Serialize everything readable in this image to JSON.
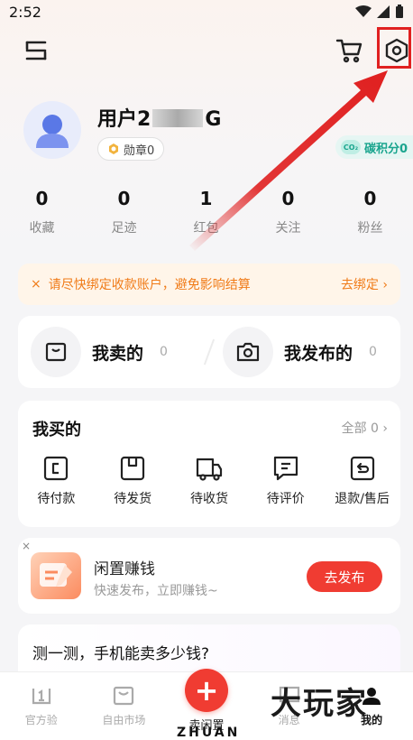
{
  "status_bar": {
    "time": "2:52"
  },
  "profile": {
    "username_prefix": "用户2",
    "username_suffix": "G",
    "badge_label": "勋章0",
    "carbon_label": "碳积分0",
    "co2_text": "CO₂"
  },
  "stats": [
    {
      "value": "0",
      "label": "收藏"
    },
    {
      "value": "0",
      "label": "足迹"
    },
    {
      "value": "1",
      "label": "红包"
    },
    {
      "value": "0",
      "label": "关注"
    },
    {
      "value": "0",
      "label": "粉丝"
    }
  ],
  "notice": {
    "close": "×",
    "message": "请尽快绑定收款账户，避免影响结算",
    "action": "去绑定 ›"
  },
  "sell": {
    "sold_label": "我卖的",
    "sold_count": "0",
    "published_label": "我发布的",
    "published_count": "0"
  },
  "bought": {
    "title": "我买的",
    "all_label": "全部 0 ›",
    "items": [
      {
        "label": "待付款",
        "icon": "pay-icon"
      },
      {
        "label": "待发货",
        "icon": "ship-icon"
      },
      {
        "label": "待收货",
        "icon": "truck-icon"
      },
      {
        "label": "待评价",
        "icon": "review-icon"
      },
      {
        "label": "退款/售后",
        "icon": "refund-icon"
      }
    ]
  },
  "promo": {
    "close": "×",
    "title": "闲置赚钱",
    "subtitle": "快速发布，立即赚钱~",
    "button": "去发布"
  },
  "quiz": {
    "title": "测一测，手机能卖多少钱?"
  },
  "bottom_nav": {
    "items": [
      {
        "label": "官方验"
      },
      {
        "label": "自由市场"
      },
      {
        "label": "卖闲置"
      },
      {
        "label": "消息"
      },
      {
        "label": "我的"
      }
    ],
    "fab_symbol": "+"
  },
  "watermark": {
    "text": "大玩家",
    "brand": "ZHUAN"
  },
  "colors": {
    "accent": "#f03c32",
    "notice": "#f07b18",
    "carbon": "#1aa58e",
    "highlight": "#e02020"
  }
}
